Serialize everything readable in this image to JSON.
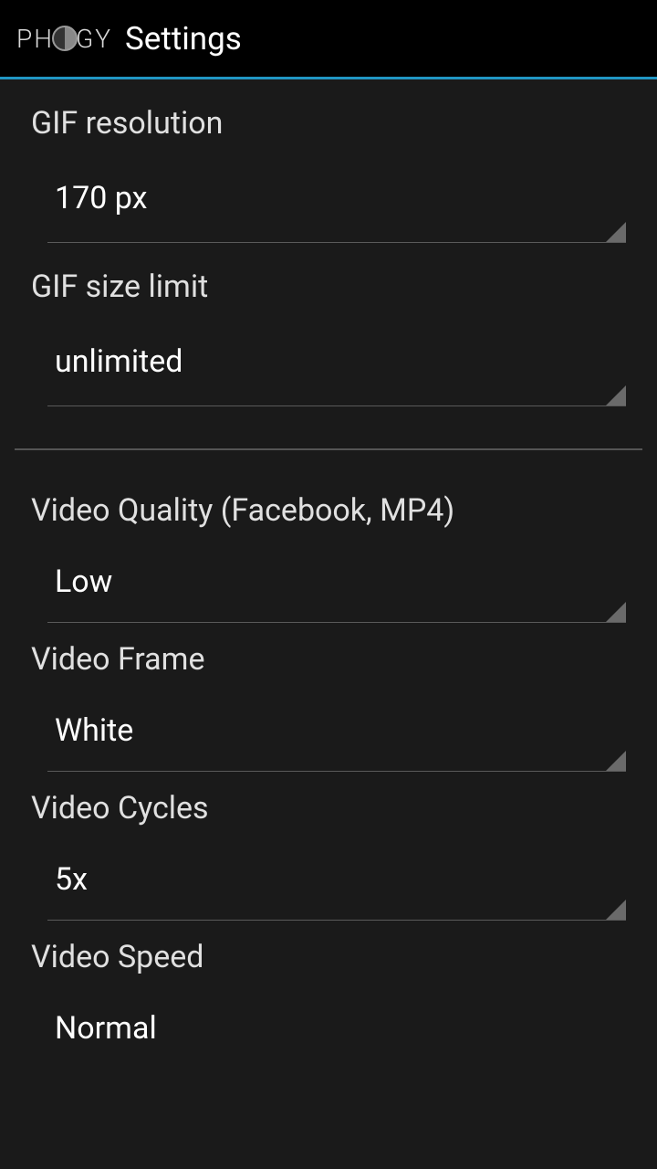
{
  "header": {
    "app_name": "PHOGY",
    "title": "Settings"
  },
  "settings": {
    "gif_resolution": {
      "label": "GIF resolution",
      "value": "170 px"
    },
    "gif_size_limit": {
      "label": "GIF size limit",
      "value": "unlimited"
    },
    "video_quality": {
      "label": "Video Quality (Facebook, MP4)",
      "value": "Low"
    },
    "video_frame": {
      "label": "Video Frame",
      "value": "White"
    },
    "video_cycles": {
      "label": "Video Cycles",
      "value": "5x"
    },
    "video_speed": {
      "label": "Video Speed",
      "value": "Normal"
    }
  }
}
